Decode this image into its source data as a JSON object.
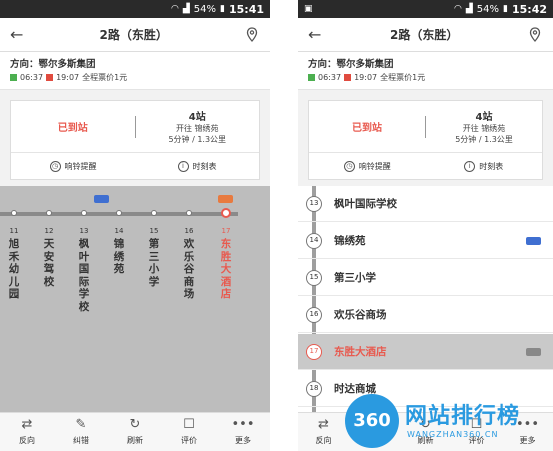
{
  "left": {
    "status": {
      "battery": "54%",
      "time": "15:41"
    },
    "header": {
      "title": "2路（东胜）"
    },
    "direction": {
      "label": "方向：鄂尔多斯集团",
      "first": "06:37",
      "last": "19:07",
      "fare": "全程票价1元"
    },
    "card": {
      "arrived": "已到站",
      "stops": "4站",
      "next_line": "开往 锦绣苑",
      "eta": "5分钟 / 1.3公里",
      "alarm": "响铃提醒",
      "timetable": "时刻表"
    },
    "stops": [
      {
        "num": "11",
        "name": "旭禾幼儿园"
      },
      {
        "num": "12",
        "name": "天安驾校"
      },
      {
        "num": "13",
        "name": "枫叶国际学校"
      },
      {
        "num": "14",
        "name": "锦绣苑"
      },
      {
        "num": "15",
        "name": "第三小学"
      },
      {
        "num": "16",
        "name": "欢乐谷商场"
      },
      {
        "num": "17",
        "name": "东胜大酒店"
      }
    ],
    "toolbar": [
      "反向",
      "纠错",
      "刷新",
      "评价",
      "更多"
    ]
  },
  "right": {
    "status": {
      "battery": "54%",
      "time": "15:42"
    },
    "header": {
      "title": "2路（东胜）"
    },
    "direction": {
      "label": "方向：鄂尔多斯集团",
      "first": "06:37",
      "last": "19:07",
      "fare": "全程票价1元"
    },
    "card": {
      "arrived": "已到站",
      "stops": "4站",
      "next_line": "开往 锦绣苑",
      "eta": "5分钟 / 1.3公里",
      "alarm": "响铃提醒",
      "timetable": "时刻表"
    },
    "stops": [
      {
        "num": "13",
        "name": "枫叶国际学校"
      },
      {
        "num": "14",
        "name": "锦绣苑"
      },
      {
        "num": "15",
        "name": "第三小学"
      },
      {
        "num": "16",
        "name": "欢乐谷商场"
      },
      {
        "num": "17",
        "name": "东胜大酒店"
      },
      {
        "num": "18",
        "name": "时达商城"
      }
    ],
    "toolbar": [
      "反向",
      "纠错",
      "刷新",
      "评价",
      "更多"
    ]
  },
  "icons": [
    "back-arrow-icon",
    "map-pin-icon",
    "alarm-clock-icon",
    "info-icon",
    "bus-icon",
    "reverse-icon",
    "edit-icon",
    "refresh-icon",
    "comment-icon",
    "more-icon"
  ],
  "watermark": {
    "logo": "360",
    "cn": "网站排行榜",
    "en": "WANGZHAN360.CN"
  },
  "colors": {
    "accent_red": "#e85a4f",
    "bus_blue": "#3f6fd1",
    "track_gray": "#8a8a8a"
  }
}
